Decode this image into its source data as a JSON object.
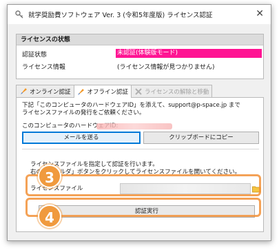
{
  "window": {
    "title": "就学奨励費ソフトウェア Ver. 3 (令和5年度版) ライセンス認証",
    "close_symbol": "✕"
  },
  "license_status": {
    "header": "ライセンスの状態",
    "auth_status_label": "認証状態",
    "auth_status_value": "未認証(体験版モード)",
    "license_info_label": "ライセンス情報",
    "license_info_value": "(ライセンス情報が見つかりません)"
  },
  "tabs": [
    {
      "label": "オンライン認証",
      "icon": "rocket-icon"
    },
    {
      "label": "オフライン認証",
      "icon": "rocket-icon"
    },
    {
      "label": "ライセンスの解除と移動",
      "icon": "x-icon"
    }
  ],
  "offline": {
    "instruction_line1": "下記「このコンピュータのハードウェアID」を添えて、support@p-space.jp まで",
    "instruction_line2": "ライセンスファイルの発行をご依頼ください。",
    "hardware_id_label": "このコンピュータのハードウェアID:",
    "send_mail_button": "メールを送る",
    "copy_clipboard_button": "クリップボードにコピー",
    "file_instruction_line1": "ライセンスファイルを指定して認証を行います。",
    "file_instruction_line2": "右の「フォルダ」ボタンをクリックしてライセンスファイルを開いてください。",
    "license_file_label": "ライセンスファイル",
    "execute_button": "認証実行"
  },
  "callouts": {
    "step3": "3",
    "step4": "4"
  },
  "colors": {
    "status_unauthenticated": "#ff1493",
    "callout": "#f09a3e",
    "focus": "#0078d7"
  }
}
